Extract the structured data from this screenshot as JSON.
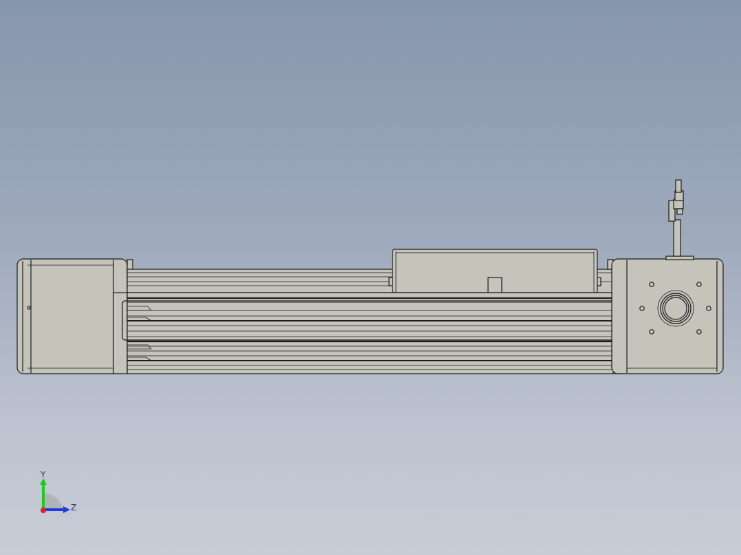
{
  "viewport": {
    "background_top": "#8696ac",
    "background_bottom": "#c8ccd6"
  },
  "part": {
    "body_color": "#c4c4bb",
    "edge_color": "#1a1a1a",
    "shade_color": "#a9a9a0"
  },
  "triad": {
    "x_label": "",
    "y_label": "Y",
    "z_label": "Z",
    "y_color": "#1ec81e",
    "z_color": "#1e3cdc",
    "x_color": "#e01e1e"
  }
}
